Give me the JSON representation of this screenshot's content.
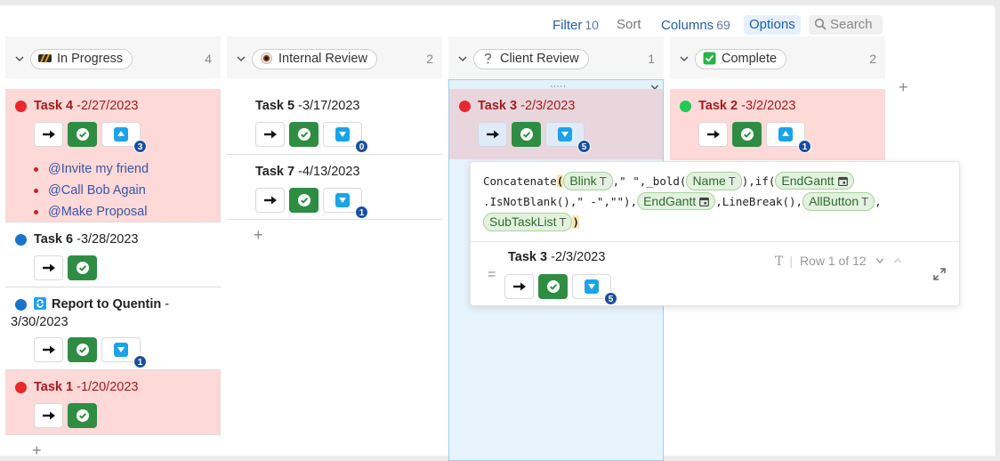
{
  "toolbar": {
    "filter_label": "Filter",
    "filter_count": "10",
    "sort_label": "Sort",
    "columns_label": "Columns",
    "columns_count": "69",
    "options_label": "Options",
    "search_label": "Search"
  },
  "columns": [
    {
      "label": "In Progress",
      "count": "4",
      "icon": "hazard-stripes-icon"
    },
    {
      "label": "Internal Review",
      "count": "2",
      "icon": "eye-icon"
    },
    {
      "label": "Client Review",
      "count": "1",
      "icon": "question-mark-icon"
    },
    {
      "label": "Complete",
      "count": "2",
      "icon": "checkbox-icon"
    }
  ],
  "cards": {
    "task4": {
      "name": "Task 4",
      "date": "-2/27/2023",
      "badge": "3",
      "items": [
        "@Invite my friend",
        "@Call Bob Again",
        "@Make Proposal"
      ]
    },
    "task6": {
      "name": "Task 6",
      "date": "-3/28/2023"
    },
    "report": {
      "name": "Report to Quentin",
      "date": "-",
      "date2": "3/30/2023",
      "badge": "1"
    },
    "task1": {
      "name": "Task 1",
      "date": "-1/20/2023"
    },
    "task5": {
      "name": "Task 5",
      "date": "-3/17/2023",
      "badge": "0"
    },
    "task7": {
      "name": "Task 7",
      "date": "-4/13/2023",
      "badge": "1"
    },
    "task3": {
      "name": "Task 3",
      "date": "-2/3/2023",
      "badge": "5"
    },
    "task2": {
      "name": "Task 2",
      "date": "-3/2/2023",
      "badge": "1"
    }
  },
  "formula": {
    "fn_concat": "Concatenate",
    "open_paren": "(",
    "chip_blink": "Blink",
    "s1": ",\" \",_bold(",
    "chip_name": "Name",
    "s2": "),if(",
    "chip_endgantt": "EndGantt",
    "s3": ".IsNotBlank(),\" -\",\"\"),",
    "chip_endgantt2": "EndGantt",
    "s4": ",LineBreak(),",
    "chip_allbutton": "AllButton",
    "s5": ",",
    "chip_subtasklist": "SubTaskList",
    "close_paren": ")",
    "type_text_glyph": "T"
  },
  "preview": {
    "equals": "=",
    "name": "Task 3",
    "date": "-2/3/2023",
    "badge": "5",
    "type_glyph": "T",
    "row_info": "Row 1 of 12"
  },
  "glyphs": {
    "add": "+",
    "drag_dots": "·····"
  },
  "colors": {
    "accent": "#1d5fa8",
    "in_progress_bg": "#fdd9d7",
    "check_green": "#2e8d43",
    "badge_blue": "#1a4f9c"
  }
}
